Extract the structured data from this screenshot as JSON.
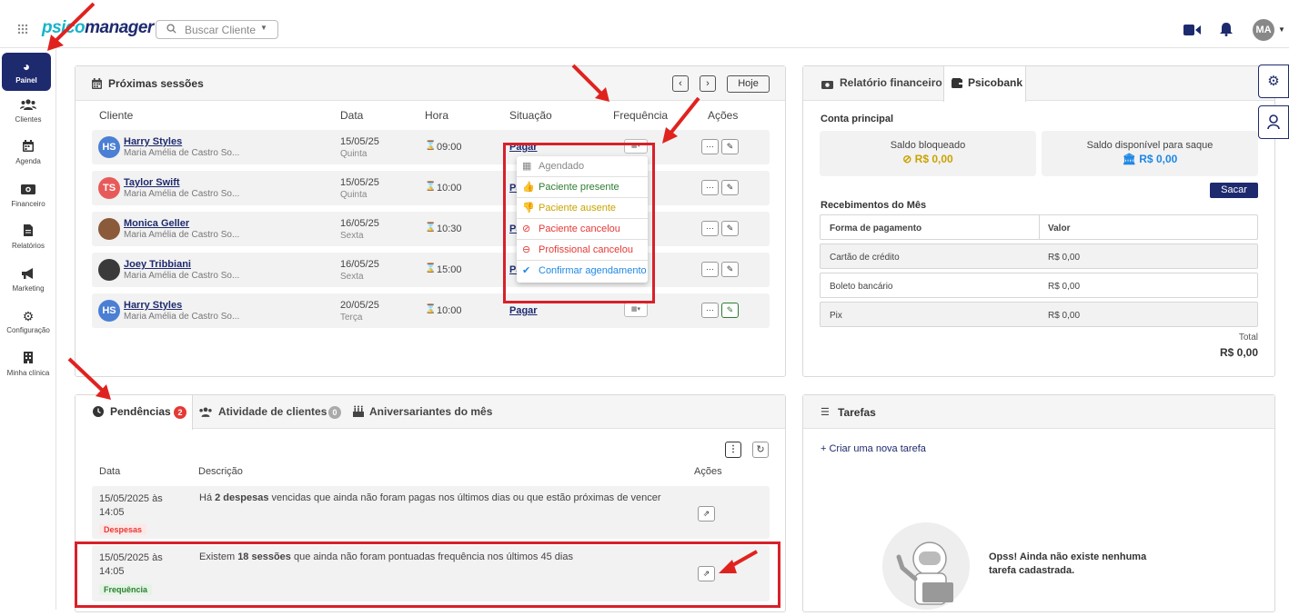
{
  "app": {
    "logo_part1": "psico",
    "logo_part2": "manager",
    "search_placeholder": "Buscar Cliente",
    "user_initials": "MA"
  },
  "sidebar": {
    "items": [
      {
        "label": "Painel"
      },
      {
        "label": "Clientes"
      },
      {
        "label": "Agenda"
      },
      {
        "label": "Financeiro"
      },
      {
        "label": "Relatórios"
      },
      {
        "label": "Marketing"
      },
      {
        "label": "Configuração"
      },
      {
        "label": "Minha clínica"
      }
    ]
  },
  "sessions": {
    "title": "Próximas sessões",
    "today_label": "Hoje",
    "headers": {
      "cliente": "Cliente",
      "data": "Data",
      "hora": "Hora",
      "situacao": "Situação",
      "frequencia": "Frequência",
      "acoes": "Ações"
    },
    "rows": [
      {
        "initials": "HS",
        "avatar_color": "#4a7fd4",
        "name": "Harry Styles",
        "sub": "Maria Amélia de Castro So...",
        "date": "15/05/25",
        "weekday": "Quinta",
        "time": "09:00",
        "status": "Pagar"
      },
      {
        "initials": "TS",
        "avatar_color": "#e85a5a",
        "name": "Taylor Swift",
        "sub": "Maria Amélia de Castro So...",
        "date": "15/05/25",
        "weekday": "Quinta",
        "time": "10:00",
        "status": "Pagar"
      },
      {
        "initials": "",
        "avatar_color": "#8a5a3a",
        "name": "Monica Geller",
        "sub": "Maria Amélia de Castro So...",
        "date": "16/05/25",
        "weekday": "Sexta",
        "time": "10:30",
        "status": "Pagar"
      },
      {
        "initials": "",
        "avatar_color": "#3a3a3a",
        "name": "Joey Tribbiani",
        "sub": "Maria Amélia de Castro So...",
        "date": "16/05/25",
        "weekday": "Sexta",
        "time": "15:00",
        "status": "Pagar"
      },
      {
        "initials": "HS",
        "avatar_color": "#4a7fd4",
        "name": "Harry Styles",
        "sub": "Maria Amélia de Castro So...",
        "date": "20/05/25",
        "weekday": "Terça",
        "time": "10:00",
        "status": "Pagar"
      }
    ]
  },
  "freq_dropdown": {
    "items": [
      {
        "label": "Agendado",
        "color": "#888888"
      },
      {
        "label": "Paciente presente",
        "color": "#2e7d32"
      },
      {
        "label": "Paciente ausente",
        "color": "#c9a400"
      },
      {
        "label": "Paciente cancelou",
        "color": "#e53935"
      },
      {
        "label": "Profissional cancelou",
        "color": "#e53935"
      },
      {
        "label": "Confirmar agendamento",
        "color": "#1e88e5"
      }
    ]
  },
  "finance": {
    "tab1": "Relatório financeiro",
    "tab2": "Psicobank",
    "account_label": "Conta principal",
    "blocked_label": "Saldo bloqueado",
    "blocked_value": "R$ 0,00",
    "available_label": "Saldo disponível para saque",
    "available_value": "R$ 0,00",
    "withdraw": "Sacar",
    "month_label": "Recebimentos do Mês",
    "col1": "Forma de pagamento",
    "col2": "Valor",
    "rows": [
      {
        "method": "Cartão de crédito",
        "value": "R$ 0,00"
      },
      {
        "method": "Boleto bancário",
        "value": "R$ 0,00"
      },
      {
        "method": "Pix",
        "value": "R$ 0,00"
      }
    ],
    "total_label": "Total",
    "total_value": "R$ 0,00"
  },
  "pending": {
    "tab1": "Pendências",
    "tab1_count": "2",
    "tab2": "Atividade de clientes",
    "tab2_count": "0",
    "tab3": "Aniversariantes do mês",
    "headers": {
      "data": "Data",
      "descricao": "Descrição",
      "acoes": "Ações"
    },
    "rows": [
      {
        "date": "15/05/2025 às 14:05",
        "desc_pre": "Há ",
        "desc_bold": "2 despesas",
        "desc_post": " vencidas que ainda não foram pagas nos últimos dias ou que estão próximas de vencer",
        "tag": "Despesas"
      },
      {
        "date": "15/05/2025 às 14:05",
        "desc_pre": "Existem ",
        "desc_bold": "18 sessões",
        "desc_post": " que ainda não foram pontuadas frequência nos últimos 45 dias",
        "tag": "Frequência"
      }
    ]
  },
  "tasks": {
    "title": "Tarefas",
    "create": "Criar uma nova tarefa",
    "empty": "Opss! Ainda não existe nenhuma tarefa cadastrada."
  }
}
